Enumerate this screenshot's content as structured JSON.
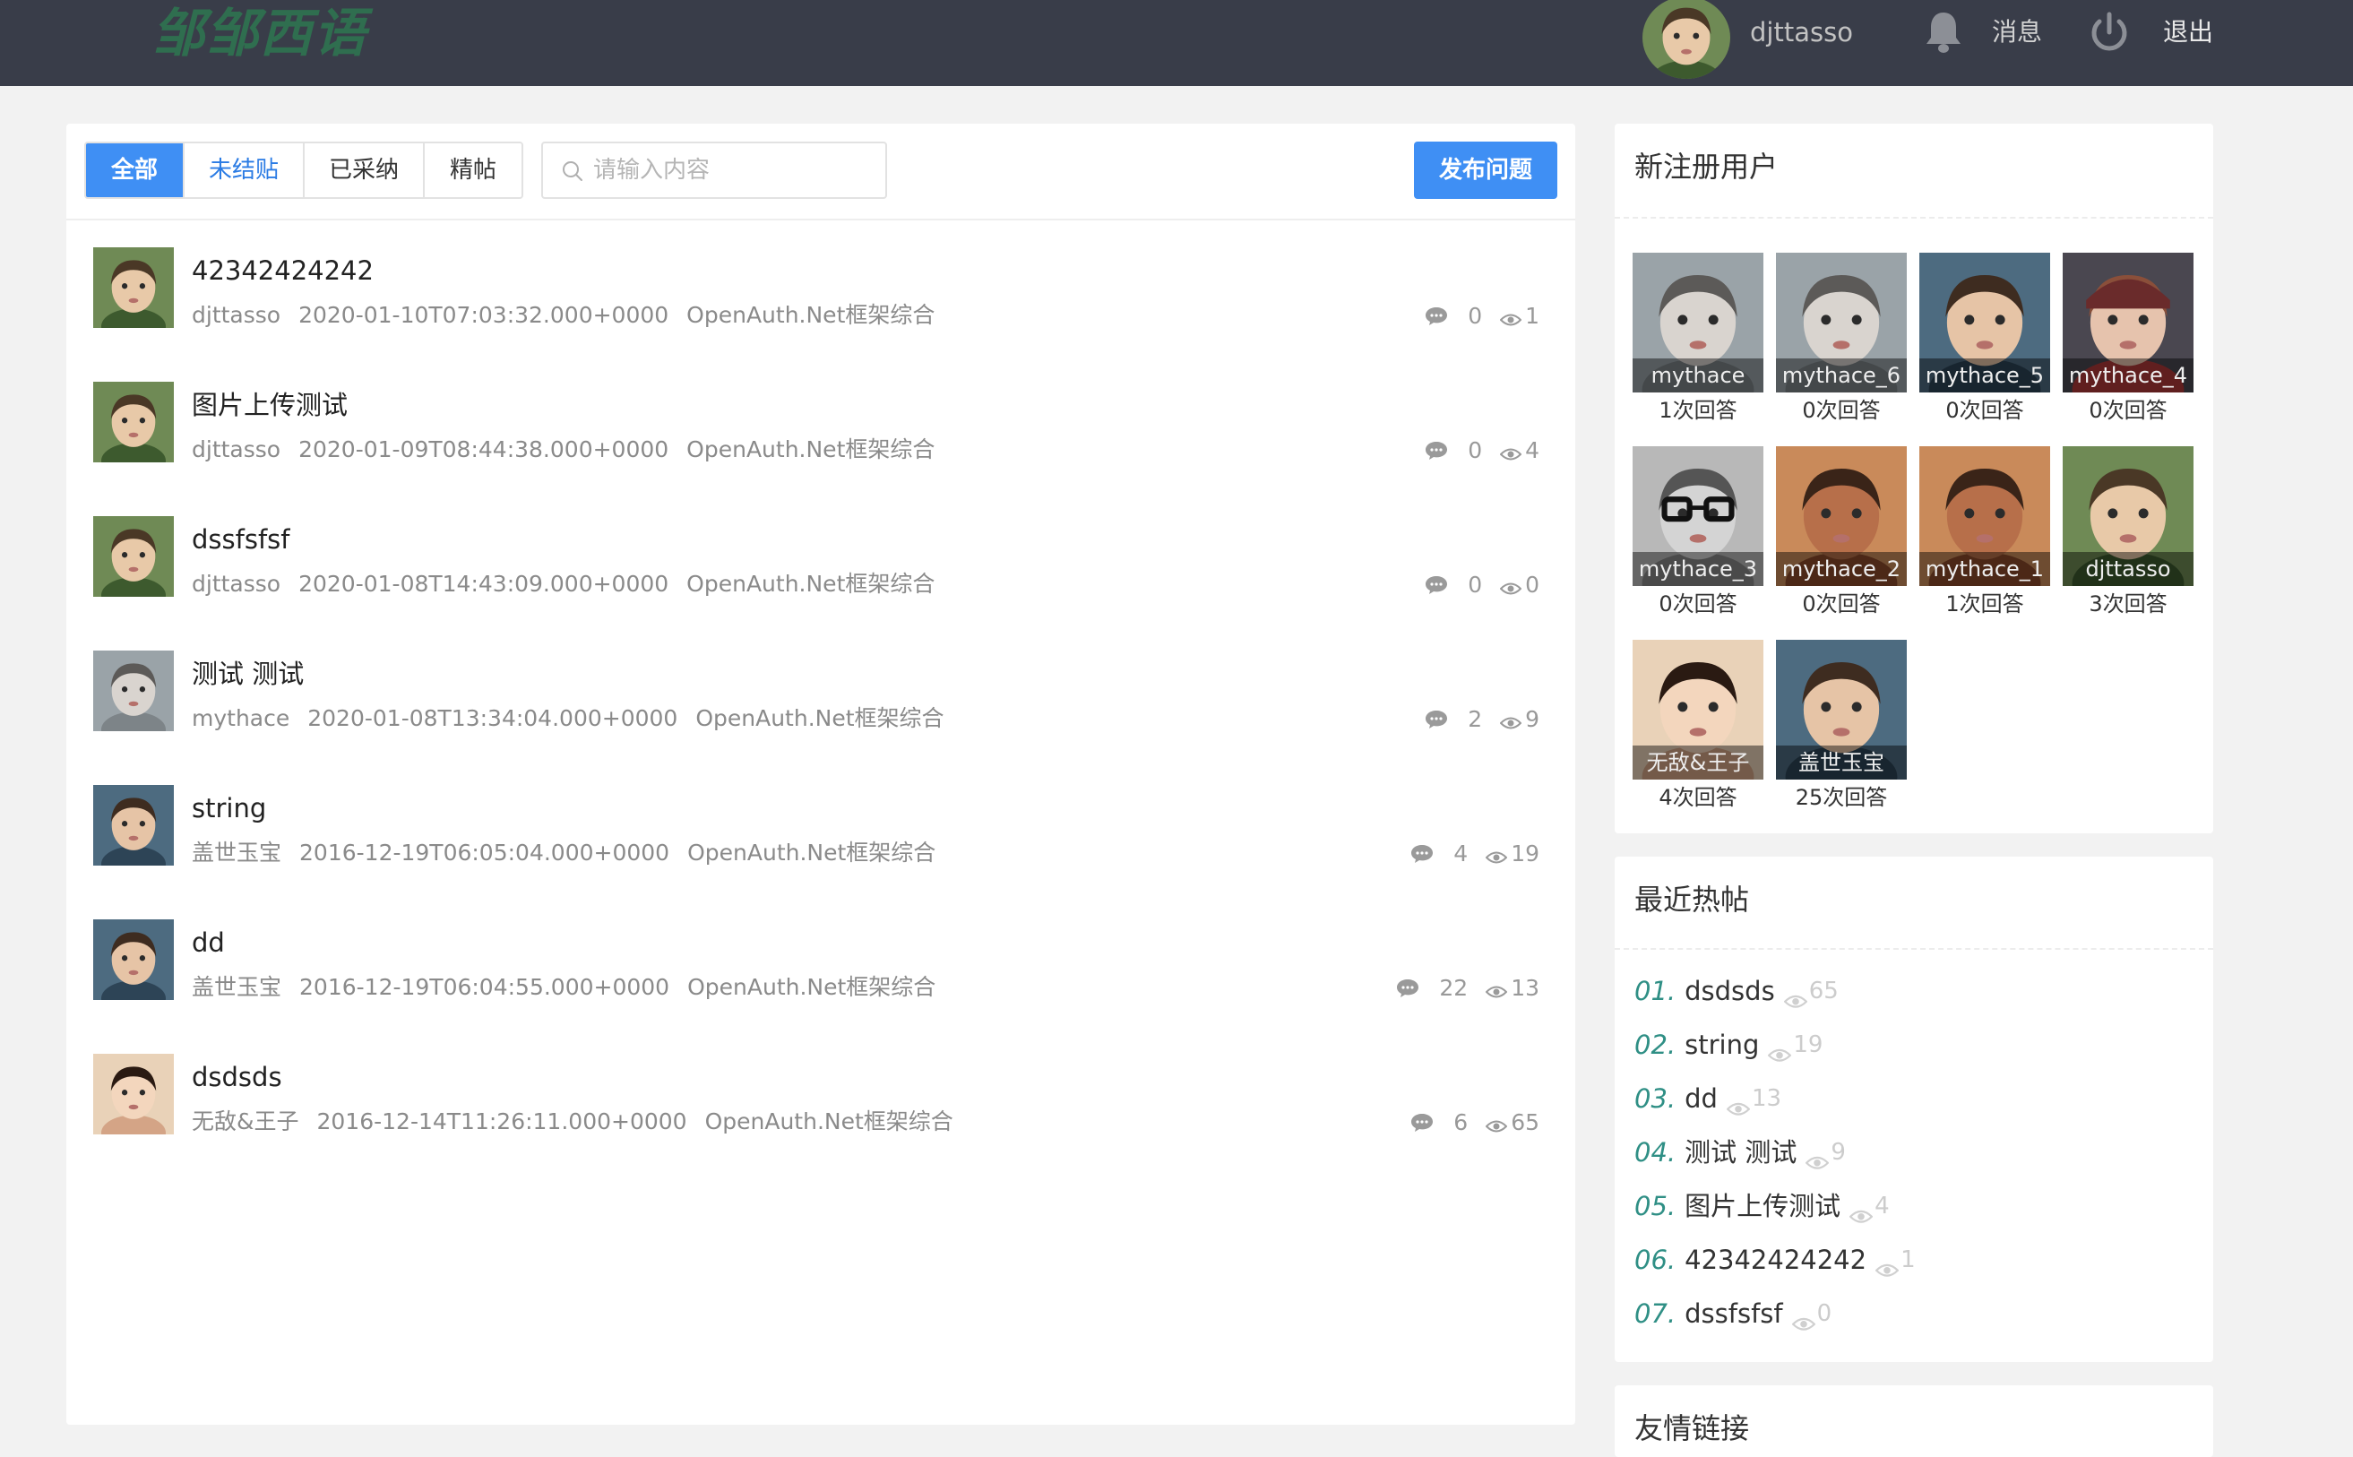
{
  "header": {
    "logo": "邹邹西语",
    "username": "djttasso",
    "messages_label": "消息",
    "logout_label": "退出"
  },
  "toolbar": {
    "tabs": [
      "全部",
      "未结贴",
      "已采纳",
      "精帖"
    ],
    "active_tab": "全部",
    "search_placeholder": "请输入内容",
    "publish_label": "发布问题"
  },
  "posts": [
    {
      "title": "42342424242",
      "author": "djttasso",
      "time": "2020-01-10T07:03:32.000+0000",
      "category": "OpenAuth.Net框架综合",
      "comments": "0",
      "views": "1",
      "avatar": "boy-green"
    },
    {
      "title": "图片上传测试",
      "author": "djttasso",
      "time": "2020-01-09T08:44:38.000+0000",
      "category": "OpenAuth.Net框架综合",
      "comments": "0",
      "views": "4",
      "avatar": "boy-green"
    },
    {
      "title": "dssfsfsf",
      "author": "djttasso",
      "time": "2020-01-08T14:43:09.000+0000",
      "category": "OpenAuth.Net框架综合",
      "comments": "0",
      "views": "0",
      "avatar": "boy-green"
    },
    {
      "title": "测试 测试",
      "author": "mythace",
      "time": "2020-01-08T13:34:04.000+0000",
      "category": "OpenAuth.Net框架综合",
      "comments": "2",
      "views": "9",
      "avatar": "child-gray"
    },
    {
      "title": "string",
      "author": "盖世玉宝",
      "time": "2016-12-19T06:05:04.000+0000",
      "category": "OpenAuth.Net框架综合",
      "comments": "4",
      "views": "19",
      "avatar": "boy-blue"
    },
    {
      "title": "dd",
      "author": "盖世玉宝",
      "time": "2016-12-19T06:04:55.000+0000",
      "category": "OpenAuth.Net框架综合",
      "comments": "22",
      "views": "13",
      "avatar": "boy-blue"
    },
    {
      "title": "dsdsds",
      "author": "无敌&王子",
      "time": "2016-12-14T11:26:11.000+0000",
      "category": "OpenAuth.Net框架综合",
      "comments": "6",
      "views": "65",
      "avatar": "girl-warm"
    }
  ],
  "new_users": {
    "title": "新注册用户",
    "users": [
      {
        "name": "mythace",
        "answers": "1次回答",
        "avatar": "child-gray"
      },
      {
        "name": "mythace_6",
        "answers": "0次回答",
        "avatar": "child-gray"
      },
      {
        "name": "mythace_5",
        "answers": "0次回答",
        "avatar": "boy-blue"
      },
      {
        "name": "mythace_4",
        "answers": "0次回答",
        "avatar": "girl-hat"
      },
      {
        "name": "mythace_3",
        "answers": "0次回答",
        "avatar": "glasses-bw"
      },
      {
        "name": "mythace_2",
        "answers": "0次回答",
        "avatar": "cartoon"
      },
      {
        "name": "mythace_1",
        "answers": "1次回答",
        "avatar": "cartoon"
      },
      {
        "name": "djttasso",
        "answers": "3次回答",
        "avatar": "boy-green"
      },
      {
        "name": "无敌&王子",
        "answers": "4次回答",
        "avatar": "girl-warm"
      },
      {
        "name": "盖世玉宝",
        "answers": "25次回答",
        "avatar": "boy-blue"
      }
    ]
  },
  "hot_posts": {
    "title": "最近热帖",
    "items": [
      {
        "num": "01.",
        "title": "dsdsds",
        "views": "65"
      },
      {
        "num": "02.",
        "title": "string",
        "views": "19"
      },
      {
        "num": "03.",
        "title": "dd",
        "views": "13"
      },
      {
        "num": "04.",
        "title": "测试 测试",
        "views": "9"
      },
      {
        "num": "05.",
        "title": "图片上传测试",
        "views": "4"
      },
      {
        "num": "06.",
        "title": "42342424242",
        "views": "1"
      },
      {
        "num": "07.",
        "title": "dssfsfsf",
        "views": "0"
      }
    ]
  },
  "links_card": {
    "title": "友情链接"
  },
  "colors": {
    "header_bg": "#393d49",
    "accent": "#3f8ff4",
    "hot_number": "#2f8f85",
    "page_bg": "#f2f2f2"
  }
}
